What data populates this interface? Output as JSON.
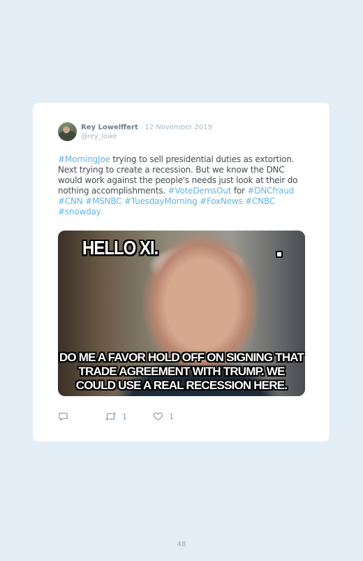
{
  "tweet": {
    "author_name": "Rey Lowelffert",
    "separator": "·",
    "date": "12 November 2019",
    "handle": "@rey_lowe",
    "text": [
      {
        "t": "#MorningJoe",
        "tag": true
      },
      {
        "t": " trying to sell presidential duties as extortion. Next trying to create a recession. But we know the DNC would work against the people's needs just look at their do nothing accomplishments. ",
        "tag": false
      },
      {
        "t": "#VoteDemsOut",
        "tag": true
      },
      {
        "t": " for ",
        "tag": false
      },
      {
        "t": "#DNCfraud",
        "tag": true
      },
      {
        "t": " ",
        "tag": false
      },
      {
        "t": "#CNN",
        "tag": true
      },
      {
        "t": " ",
        "tag": false
      },
      {
        "t": "#MSNBC",
        "tag": true
      },
      {
        "t": " ",
        "tag": false
      },
      {
        "t": "#TuesdayMorning",
        "tag": true
      },
      {
        "t": " ",
        "tag": false
      },
      {
        "t": "#FoxNews",
        "tag": true
      },
      {
        "t": " ",
        "tag": false
      },
      {
        "t": "#CNBC",
        "tag": true
      },
      {
        "t": " ",
        "tag": false
      },
      {
        "t": "#snowday",
        "tag": true
      }
    ],
    "meme": {
      "top_text": "HELLO XI.",
      "bottom_line1": "DO ME A FAVOR HOLD OFF ON SIGNING THAT",
      "bottom_line2": "TRADE AGREEMENT WITH TRUMP. WE",
      "bottom_line3": "COULD USE A REAL RECESSION HERE."
    },
    "actions": {
      "reply_icon": "reply-icon",
      "retweet_icon": "retweet-icon",
      "retweet_count": "1",
      "like_icon": "heart-icon",
      "like_count": "1"
    }
  },
  "page_number": "48",
  "colors": {
    "background": "#e3eef6",
    "card": "#ffffff",
    "hashtag": "#62b5e5",
    "body_text": "#454d54",
    "muted": "#a7b8c4"
  }
}
